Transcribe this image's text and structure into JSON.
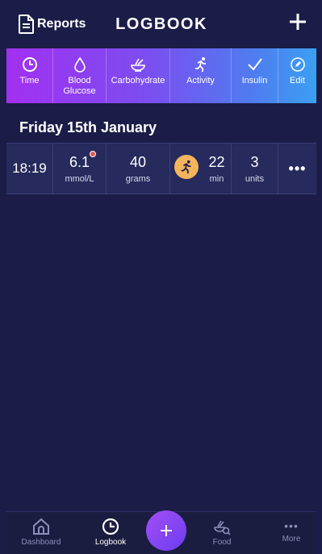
{
  "header": {
    "reports_label": "Reports",
    "title": "LOGBOOK"
  },
  "columns": [
    {
      "label": "Time",
      "icon": "clock-icon"
    },
    {
      "label": "Blood Glucose",
      "icon": "drop-icon"
    },
    {
      "label": "Carbohydrate",
      "icon": "bowl-icon"
    },
    {
      "label": "Activity",
      "icon": "running-icon"
    },
    {
      "label": "Insulin",
      "icon": "check-icon"
    },
    {
      "label": "Edit",
      "icon": "pencil-icon"
    }
  ],
  "date_heading": "Friday 15th January",
  "entry": {
    "time": "18:19",
    "glucose_value": "6.1",
    "glucose_unit": "mmol/L",
    "carbs_value": "40",
    "carbs_unit": "grams",
    "activity_value": "22",
    "activity_unit": "min",
    "insulin_value": "3",
    "insulin_unit": "units",
    "more": "•••"
  },
  "nav": {
    "dashboard": "Dashboard",
    "logbook": "Logbook",
    "food": "Food",
    "more": "More",
    "more_dots": "•••"
  },
  "colors": {
    "background": "#1b1d48",
    "row": "#262a5c",
    "activity_badge": "#f4b35d",
    "glucose_dot": "#e05b5b"
  }
}
